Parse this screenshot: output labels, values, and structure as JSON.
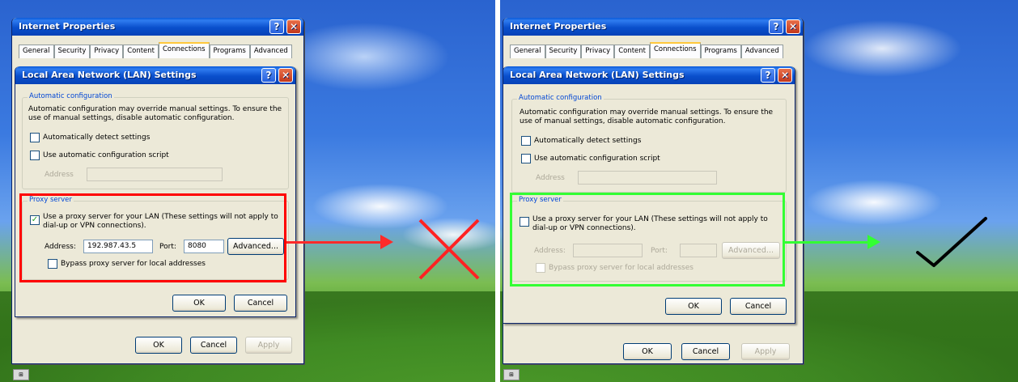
{
  "left": {
    "window_title": "Internet Properties",
    "tabs": [
      "General",
      "Security",
      "Privacy",
      "Content",
      "Connections",
      "Programs",
      "Advanced"
    ],
    "active_tab": "Connections",
    "dialog_title": "Local Area Network (LAN) Settings",
    "auto_group": "Automatic configuration",
    "auto_desc_1": "Automatic configuration may override manual settings.  To ensure the",
    "auto_desc_2": "use of manual settings, disable automatic configuration.",
    "auto_detect": "Automatically detect settings",
    "auto_script": "Use automatic configuration script",
    "address_label": "Address",
    "proxy_group": "Proxy server",
    "proxy_use_1": "Use a proxy server for your LAN (These settings will not apply to",
    "proxy_use_2": "dial-up or VPN connections).",
    "proxy_checked": "✓",
    "proxy_address_label": "Address:",
    "proxy_address_value": "192.987.43.5",
    "port_label": "Port:",
    "port_value": "8080",
    "advanced": "Advanced...",
    "bypass": "Bypass proxy server for local addresses",
    "ok": "OK",
    "cancel": "Cancel",
    "main_ok": "OK",
    "main_cancel": "Cancel",
    "main_apply": "Apply"
  },
  "right": {
    "window_title": "Internet Properties",
    "tabs": [
      "General",
      "Security",
      "Privacy",
      "Content",
      "Connections",
      "Programs",
      "Advanced"
    ],
    "active_tab": "Connections",
    "dialog_title": "Local Area Network (LAN) Settings",
    "auto_group": "Automatic configuration",
    "auto_desc_1": "Automatic configuration may override manual settings.  To ensure the",
    "auto_desc_2": "use of manual settings, disable automatic configuration.",
    "auto_detect": "Automatically detect settings",
    "auto_script": "Use automatic configuration script",
    "address_label": "Address",
    "proxy_group": "Proxy server",
    "proxy_use_1": "Use a proxy server for your LAN (These settings will not apply to",
    "proxy_use_2": "dial-up or VPN connections).",
    "proxy_address_label": "Address:",
    "port_label": "Port:",
    "advanced": "Advanced...",
    "bypass": "Bypass proxy server for local addresses",
    "ok": "OK",
    "cancel": "Cancel",
    "main_ok": "OK",
    "main_cancel": "Cancel",
    "main_apply": "Apply"
  },
  "colors": {
    "wrong_highlight": "#ff0000",
    "right_highlight": "#33ff33",
    "cross": "#ff2222",
    "check": "#000000"
  }
}
